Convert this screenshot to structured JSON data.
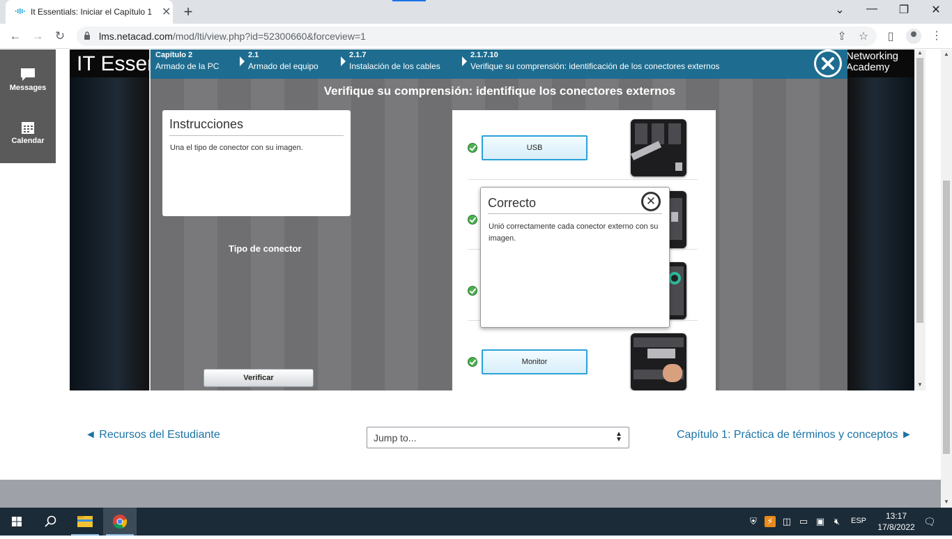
{
  "browser": {
    "tab_title": "It Essentials: Iniciar el Capítulo 1",
    "tab_close": "✕",
    "new_tab": "+",
    "url_host": "lms.netacad.com",
    "url_path": "/mod/lti/view.php?id=52300660&forceview=1"
  },
  "leftnav": {
    "messages": "Messages",
    "calendar": "Calendar"
  },
  "activity": {
    "bg_title": "IT Essen",
    "right_logo_line1": "Networking",
    "right_logo_line2": "Academy"
  },
  "breadcrumb": [
    {
      "num": "Capítulo 2",
      "label": "Armado de la PC"
    },
    {
      "num": "2.1",
      "label": "Armado del equipo"
    },
    {
      "num": "2.1.7",
      "label": "Instalación de los cables"
    },
    {
      "num": "2.1.7.10",
      "label": "Verifique su comprensión: identificación de los conectores externos"
    }
  ],
  "module": {
    "title": "Verifique su comprensión: identifique los conectores externos",
    "instructions_heading": "Instrucciones",
    "instructions_text": "Una el tipo de conector con su imagen.",
    "connector_type_label": "Tipo de conector",
    "verify_button": "Verificar",
    "rows": [
      {
        "label": "USB",
        "status": "correct"
      },
      {
        "label": "",
        "status": "correct"
      },
      {
        "label": "",
        "status": "correct"
      },
      {
        "label": "Monitor",
        "status": "correct"
      }
    ]
  },
  "dialog": {
    "title": "Correcto",
    "body": "Unió correctamente cada conector externo con su imagen."
  },
  "pagenav": {
    "prev": "◄ Recursos del Estudiante",
    "jump_placeholder": "Jump to...",
    "next": "Capítulo 1: Práctica de términos y conceptos ►"
  },
  "taskbar": {
    "lang": "ESP",
    "time": "13:17",
    "date": "17/8/2022"
  },
  "colors": {
    "breadcrumb_bg": "#1e6d90",
    "link": "#1a73a6",
    "taskbar": "#1b2b38"
  }
}
